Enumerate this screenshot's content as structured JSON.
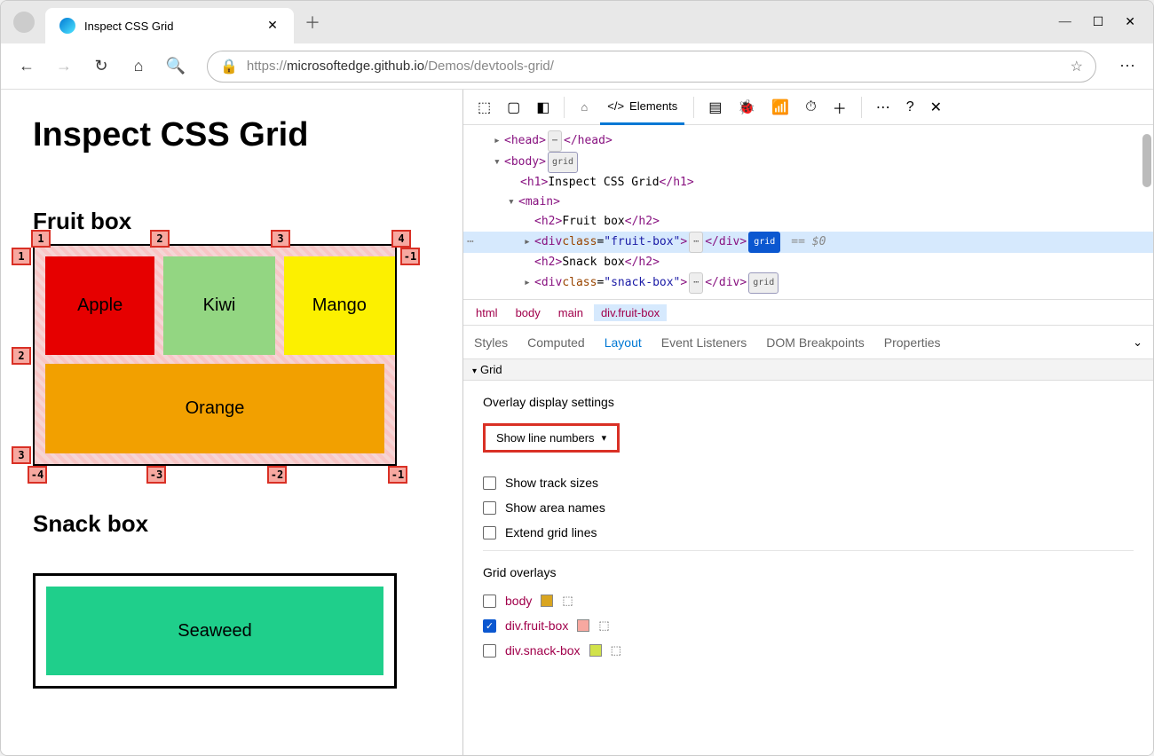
{
  "browser": {
    "tabTitle": "Inspect CSS Grid",
    "url": {
      "prefix": "https://",
      "host": "microsoftedge.github.io",
      "path": "/Demos/devtools-grid/"
    }
  },
  "page": {
    "h1": "Inspect CSS Grid",
    "fruit": {
      "title": "Fruit box",
      "apple": "Apple",
      "kiwi": "Kiwi",
      "mango": "Mango",
      "orange": "Orange"
    },
    "snack": {
      "title": "Snack box",
      "seaweed": "Seaweed"
    },
    "lineNumbers": {
      "top": [
        "1",
        "2",
        "3",
        "4"
      ],
      "left": [
        "1",
        "2",
        "3"
      ],
      "right": [
        "-1"
      ],
      "bottom": [
        "-4",
        "-3",
        "-2",
        "-1"
      ]
    }
  },
  "devtools": {
    "elementsTab": "Elements",
    "dom": {
      "head": "head",
      "body": "body",
      "grid": "grid",
      "h1a": "<h1>",
      "h1txt": "Inspect CSS Grid",
      "h1b": "</h1>",
      "main": "main",
      "h2a": "<h2>",
      "fruitTxt": "Fruit box",
      "h2b": "</h2>",
      "divOpen": "<div ",
      "cls": "class",
      "fruitVal": "\"fruit-box\"",
      "snackVal": "\"snack-box\"",
      "divClose": "</div>",
      "snackTxt": "Snack box",
      "eq0": "== $0"
    },
    "crumbs": [
      "html",
      "body",
      "main",
      "div.fruit-box"
    ],
    "subTabs": [
      "Styles",
      "Computed",
      "Layout",
      "Event Listeners",
      "DOM Breakpoints",
      "Properties"
    ],
    "gridSection": "Grid",
    "overlaySettings": {
      "title": "Overlay display settings",
      "dropdown": "Show line numbers",
      "trackSizes": "Show track sizes",
      "areaNames": "Show area names",
      "extend": "Extend grid lines"
    },
    "gridOverlays": {
      "title": "Grid overlays",
      "items": [
        {
          "name": "body",
          "color": "#d9a520",
          "checked": false
        },
        {
          "name": "div.fruit-box",
          "color": "#f7a8a0",
          "checked": true
        },
        {
          "name": "div.snack-box",
          "color": "#d1e24a",
          "checked": false
        }
      ]
    }
  }
}
